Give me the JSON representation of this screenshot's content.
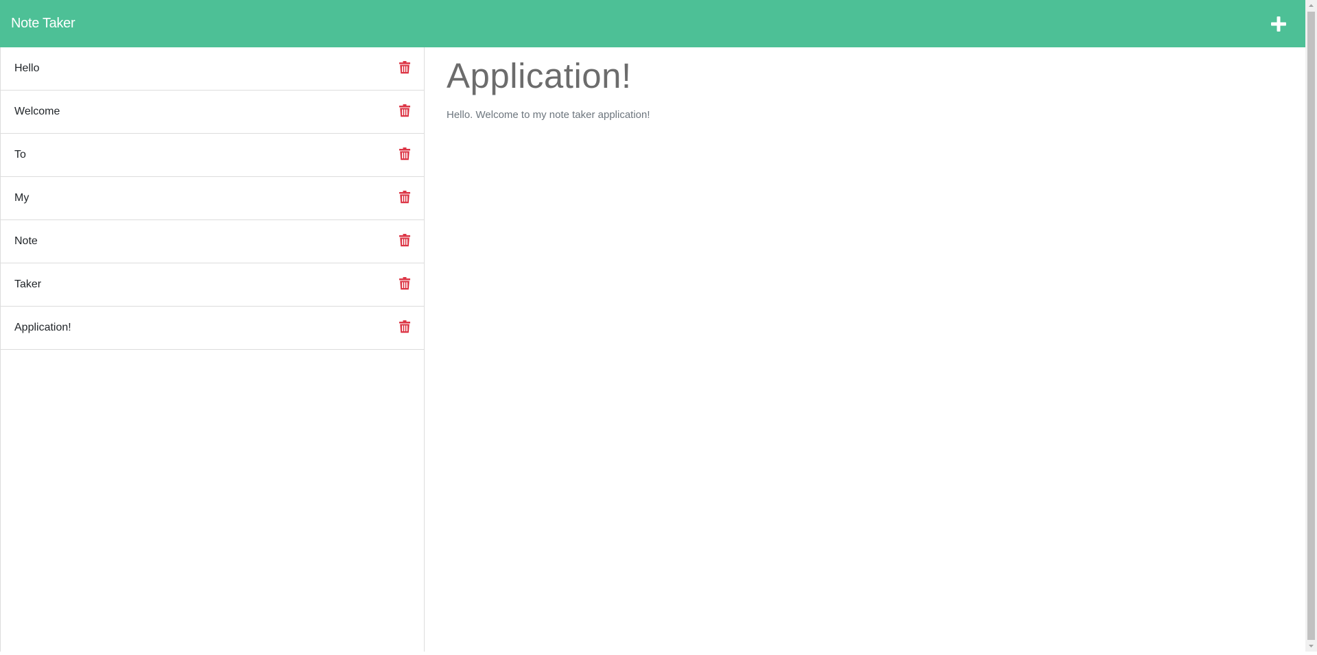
{
  "navbar": {
    "brand": "Note Taker",
    "new_note_icon": "plus-icon"
  },
  "colors": {
    "accent": "#4dc096",
    "danger": "#dc3545"
  },
  "sidebar": {
    "notes": [
      {
        "title": "Hello",
        "icon": "trash-icon"
      },
      {
        "title": "Welcome",
        "icon": "trash-icon"
      },
      {
        "title": "To",
        "icon": "trash-icon"
      },
      {
        "title": "My",
        "icon": "trash-icon"
      },
      {
        "title": "Note",
        "icon": "trash-icon"
      },
      {
        "title": "Taker",
        "icon": "trash-icon"
      },
      {
        "title": "Application!",
        "icon": "trash-icon"
      }
    ]
  },
  "main": {
    "title": "Application!",
    "text": "Hello. Welcome to my note taker application!"
  }
}
